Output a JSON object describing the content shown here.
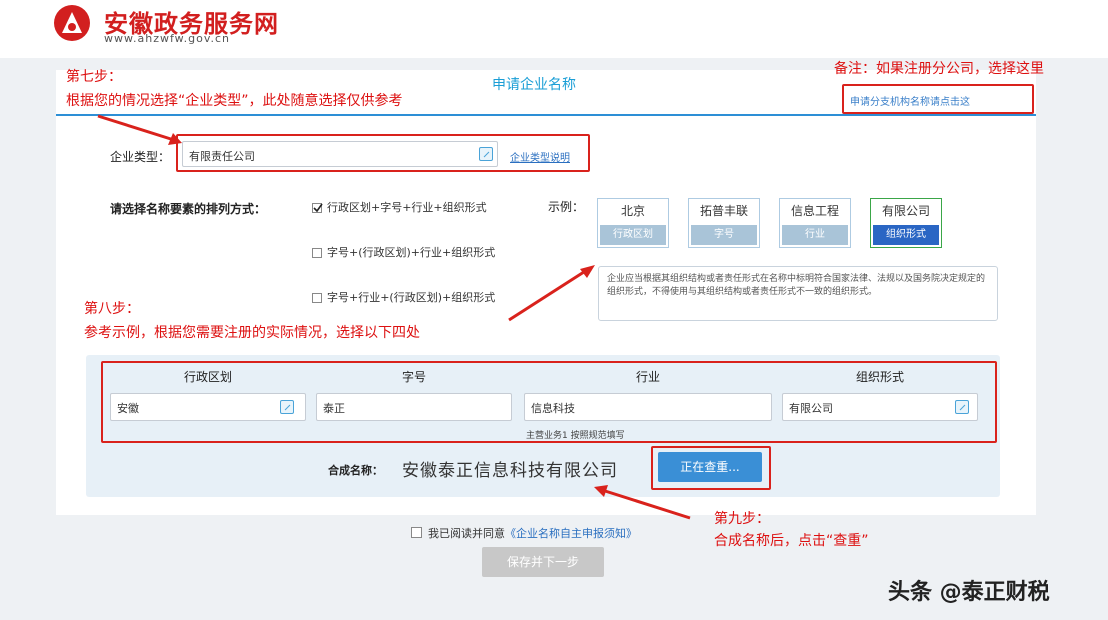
{
  "header": {
    "site_title": "安徽政务服务网",
    "site_url": "www.ahzwfw.gov.cn"
  },
  "annotations": {
    "step7_title": "第七步：",
    "step7_text": "根据您的情况选择“企业类型”，此处随意选择仅供参考",
    "note_text": "备注：如果注册分公司，选择这里",
    "step8_title": "第八步：",
    "step8_text": "参考示例，根据您需要注册的实际情况，选择以下四处",
    "step9_title": "第九步：",
    "step9_text": "合成名称后，点击“查重”"
  },
  "panel": {
    "title": "申请企业名称",
    "branch_link": "申请分支机构名称请点击这"
  },
  "enterprise_type": {
    "label": "企业类型：",
    "value": "有限责任公司",
    "link": "企业类型说明"
  },
  "order": {
    "label": "请选择名称要素的排列方式：",
    "options": [
      {
        "label": "行政区划+字号+行业+组织形式",
        "checked": true
      },
      {
        "label": "字号+(行政区划)+行业+组织形式",
        "checked": false
      },
      {
        "label": "字号+行业+(行政区划)+组织形式",
        "checked": false
      }
    ]
  },
  "example": {
    "label": "示例：",
    "boxes": [
      {
        "top": "北京",
        "bottom": "行政区划"
      },
      {
        "top": "拓普丰联",
        "bottom": "字号"
      },
      {
        "top": "信息工程",
        "bottom": "行业"
      },
      {
        "top": "有限公司",
        "bottom": "组织形式"
      }
    ],
    "tip": "企业应当根据其组织结构或者责任形式在名称中标明符合国家法律、法规以及国务院决定规定的组织形式，不得使用与其组织结构或者责任形式不一致的组织形式。"
  },
  "components": {
    "headers": [
      "行政区划",
      "字号",
      "行业",
      "组织形式"
    ],
    "values": [
      "安徽",
      "泰正",
      "信息科技",
      "有限公司"
    ],
    "hint": "主营业务1 按照规范填写"
  },
  "compose": {
    "label": "合成名称：",
    "value": "安徽泰正信息科技有限公司",
    "button": "正在查重..."
  },
  "agree": {
    "text": "我已阅读并同意",
    "link": "《企业名称自主申报须知》",
    "checked": false
  },
  "next_button": "保存并下一步",
  "watermark": "头条 @泰正财税",
  "colors": {
    "accent": "#2d8fd6",
    "annotation_red": "#d9221c",
    "brand_red": "#d21f1f"
  }
}
